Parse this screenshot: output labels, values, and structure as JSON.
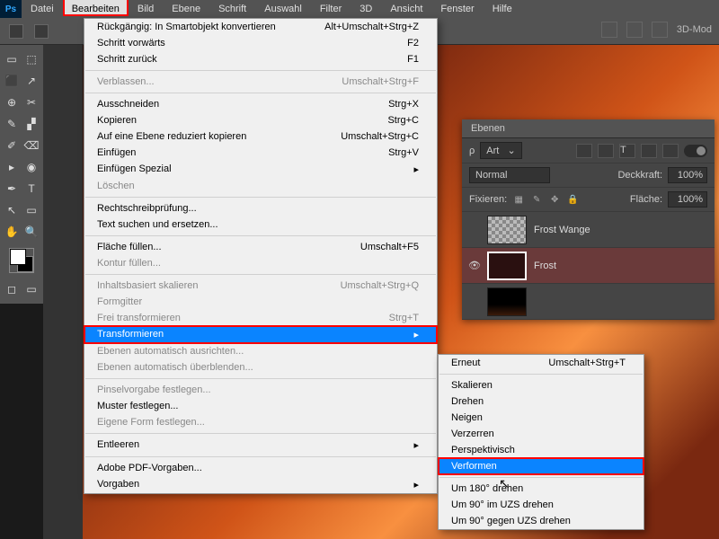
{
  "menubar": {
    "items": [
      "Datei",
      "Bearbeiten",
      "Bild",
      "Ebene",
      "Schrift",
      "Auswahl",
      "Filter",
      "3D",
      "Ansicht",
      "Fenster",
      "Hilfe"
    ],
    "active_index": 1
  },
  "optionsbar": {
    "mode3d": "3D-Mod"
  },
  "dropdown": {
    "groups": [
      [
        {
          "label": "Rückgängig: In Smartobjekt konvertieren",
          "shortcut": "Alt+Umschalt+Strg+Z"
        },
        {
          "label": "Schritt vorwärts",
          "shortcut": "F2"
        },
        {
          "label": "Schritt zurück",
          "shortcut": "F1"
        }
      ],
      [
        {
          "label": "Verblassen...",
          "shortcut": "Umschalt+Strg+F",
          "disabled": true
        }
      ],
      [
        {
          "label": "Ausschneiden",
          "shortcut": "Strg+X"
        },
        {
          "label": "Kopieren",
          "shortcut": "Strg+C"
        },
        {
          "label": "Auf eine Ebene reduziert kopieren",
          "shortcut": "Umschalt+Strg+C"
        },
        {
          "label": "Einfügen",
          "shortcut": "Strg+V"
        },
        {
          "label": "Einfügen Spezial",
          "submenu": true
        },
        {
          "label": "Löschen",
          "disabled": true
        }
      ],
      [
        {
          "label": "Rechtschreibprüfung..."
        },
        {
          "label": "Text suchen und ersetzen..."
        }
      ],
      [
        {
          "label": "Fläche füllen...",
          "shortcut": "Umschalt+F5"
        },
        {
          "label": "Kontur füllen...",
          "disabled": true
        }
      ],
      [
        {
          "label": "Inhaltsbasiert skalieren",
          "shortcut": "Umschalt+Strg+Q",
          "disabled": true
        },
        {
          "label": "Formgitter",
          "disabled": true
        },
        {
          "label": "Frei transformieren",
          "shortcut": "Strg+T",
          "disabled": true
        },
        {
          "label": "Transformieren",
          "submenu": true,
          "highlighted": true,
          "red": true
        },
        {
          "label": "Ebenen automatisch ausrichten...",
          "disabled": true
        },
        {
          "label": "Ebenen automatisch überblenden...",
          "disabled": true
        }
      ],
      [
        {
          "label": "Pinselvorgabe festlegen...",
          "disabled": true
        },
        {
          "label": "Muster festlegen..."
        },
        {
          "label": "Eigene Form festlegen...",
          "disabled": true
        }
      ],
      [
        {
          "label": "Entleeren",
          "submenu": true
        }
      ],
      [
        {
          "label": "Adobe PDF-Vorgaben..."
        },
        {
          "label": "Vorgaben",
          "submenu": true
        }
      ]
    ]
  },
  "submenu": {
    "groups": [
      [
        {
          "label": "Erneut",
          "shortcut": "Umschalt+Strg+T"
        }
      ],
      [
        {
          "label": "Skalieren"
        },
        {
          "label": "Drehen"
        },
        {
          "label": "Neigen"
        },
        {
          "label": "Verzerren"
        },
        {
          "label": "Perspektivisch"
        },
        {
          "label": "Verformen",
          "highlighted": true,
          "red": true
        }
      ],
      [
        {
          "label": "Um 180° drehen"
        },
        {
          "label": "Um 90° im UZS drehen"
        },
        {
          "label": "Um 90° gegen UZS drehen"
        }
      ]
    ]
  },
  "layers": {
    "title": "Ebenen",
    "filter_label": "Art",
    "blend": "Normal",
    "opacity_label": "Deckkraft:",
    "opacity": "100%",
    "lock_label": "Fixieren:",
    "fill_label": "Fläche:",
    "fill": "100%",
    "items": [
      {
        "name": "Frost Wange",
        "visible": false
      },
      {
        "name": "Frost",
        "visible": true,
        "selected": true
      },
      {
        "name": ""
      }
    ]
  },
  "tools": {
    "rows": [
      [
        "▭",
        "⬚"
      ],
      [
        "⬛",
        "↗"
      ],
      [
        "⊕",
        "✂"
      ],
      [
        "✎",
        "▞"
      ],
      [
        "✐",
        "⌫"
      ],
      [
        "▸",
        "◉"
      ],
      [
        "✒",
        "T"
      ],
      [
        "↖",
        "▭"
      ],
      [
        "✋",
        "🔍"
      ]
    ]
  }
}
